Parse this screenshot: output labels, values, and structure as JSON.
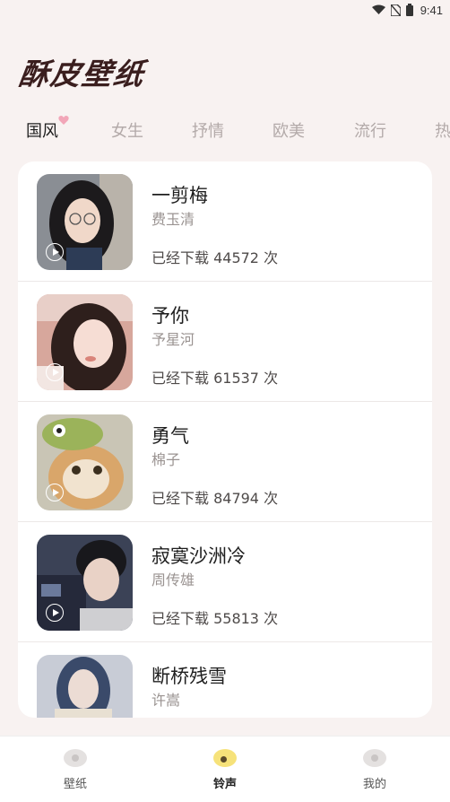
{
  "status_bar": {
    "time": "9:41",
    "icons": [
      "wifi-icon",
      "no-sim-icon",
      "battery-icon"
    ]
  },
  "app": {
    "title": "酥皮壁纸"
  },
  "tabs": [
    {
      "label": "国风",
      "active": true
    },
    {
      "label": "女生",
      "active": false
    },
    {
      "label": "抒情",
      "active": false
    },
    {
      "label": "欧美",
      "active": false
    },
    {
      "label": "流行",
      "active": false
    },
    {
      "label": "热",
      "active": false
    }
  ],
  "songs": [
    {
      "title": "一剪梅",
      "artist": "费玉清",
      "downloads": "已经下载 44572 次"
    },
    {
      "title": "予你",
      "artist": "予星河",
      "downloads": "已经下载 61537 次"
    },
    {
      "title": "勇气",
      "artist": "棉子",
      "downloads": "已经下载 84794 次"
    },
    {
      "title": "寂寞沙洲冷",
      "artist": "周传雄",
      "downloads": "已经下载 55813 次"
    },
    {
      "title": "断桥残雪",
      "artist": "许嵩",
      "downloads": ""
    }
  ],
  "bottom_nav": [
    {
      "label": "壁纸",
      "icon": "wallpaper-icon",
      "active": false
    },
    {
      "label": "铃声",
      "icon": "ringtone-icon",
      "active": true
    },
    {
      "label": "我的",
      "icon": "profile-icon",
      "active": false
    }
  ],
  "colors": {
    "background": "#f8f2f1",
    "title": "#3a1e1e",
    "active_nav": "#f6e27a",
    "heart": "#f2a6b8"
  }
}
